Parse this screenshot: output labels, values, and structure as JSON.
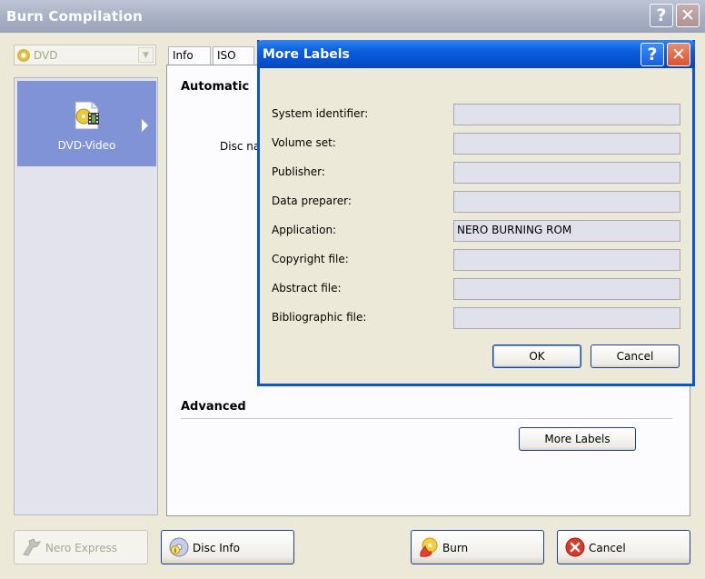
{
  "main_window": {
    "title": "Burn Compilation",
    "help_glyph": "?",
    "close_glyph": "✕"
  },
  "disc_type": {
    "selected": "DVD",
    "icon": "disc-icon"
  },
  "compilation_types": [
    {
      "label": "DVD-Video",
      "icon": "dvd-video-icon",
      "selected": true
    }
  ],
  "tabs": [
    {
      "label": "Info"
    },
    {
      "label": "ISO"
    }
  ],
  "label_tab": {
    "automatic_heading": "Automatic",
    "disc_name_label": "Disc na",
    "advanced_heading": "Advanced",
    "more_labels_button": "More Labels"
  },
  "bottom_buttons": {
    "nero_express": "Nero Express",
    "disc_info": "Disc Info",
    "burn": "Burn",
    "cancel": "Cancel"
  },
  "dialog": {
    "title": "More Labels",
    "help_glyph": "?",
    "close_glyph": "✕",
    "fields": [
      {
        "label": "System identifier:",
        "value": ""
      },
      {
        "label": "Volume set:",
        "value": ""
      },
      {
        "label": "Publisher:",
        "value": ""
      },
      {
        "label": "Data preparer:",
        "value": ""
      },
      {
        "label": "Application:",
        "value": "NERO BURNING ROM"
      },
      {
        "label": "Copyright file:",
        "value": ""
      },
      {
        "label": "Abstract file:",
        "value": ""
      },
      {
        "label": "Bibliographic file:",
        "value": ""
      }
    ],
    "ok_button": "OK",
    "cancel_button": "Cancel"
  },
  "colors": {
    "dialog_title_blue": "#0a5ddd",
    "inactive_title": "#a9b1c6",
    "selected_item_bg": "#8093d7",
    "field_bg": "#e1e1ec"
  }
}
